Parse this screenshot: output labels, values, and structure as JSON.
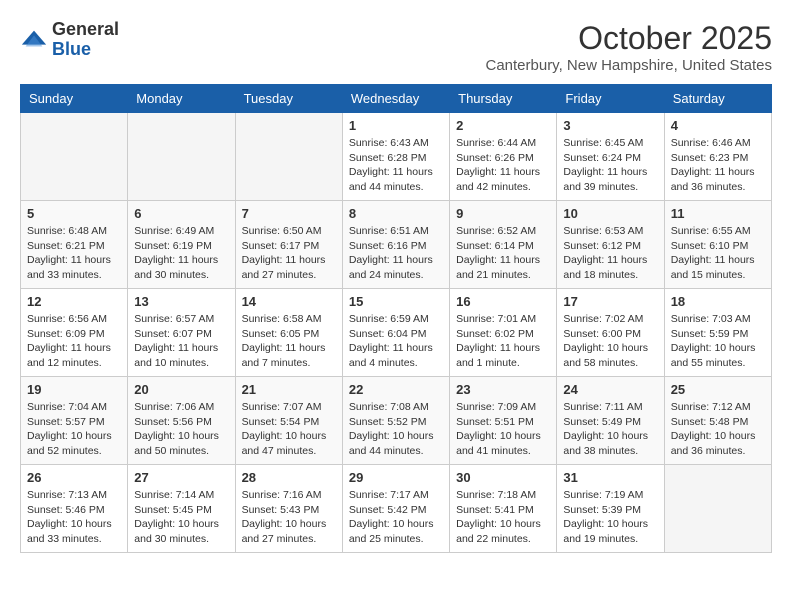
{
  "header": {
    "logo_general": "General",
    "logo_blue": "Blue",
    "month": "October 2025",
    "location": "Canterbury, New Hampshire, United States"
  },
  "weekdays": [
    "Sunday",
    "Monday",
    "Tuesday",
    "Wednesday",
    "Thursday",
    "Friday",
    "Saturday"
  ],
  "weeks": [
    [
      {
        "day": "",
        "sunrise": "",
        "sunset": "",
        "daylight": ""
      },
      {
        "day": "",
        "sunrise": "",
        "sunset": "",
        "daylight": ""
      },
      {
        "day": "",
        "sunrise": "",
        "sunset": "",
        "daylight": ""
      },
      {
        "day": "1",
        "sunrise": "Sunrise: 6:43 AM",
        "sunset": "Sunset: 6:28 PM",
        "daylight": "Daylight: 11 hours and 44 minutes."
      },
      {
        "day": "2",
        "sunrise": "Sunrise: 6:44 AM",
        "sunset": "Sunset: 6:26 PM",
        "daylight": "Daylight: 11 hours and 42 minutes."
      },
      {
        "day": "3",
        "sunrise": "Sunrise: 6:45 AM",
        "sunset": "Sunset: 6:24 PM",
        "daylight": "Daylight: 11 hours and 39 minutes."
      },
      {
        "day": "4",
        "sunrise": "Sunrise: 6:46 AM",
        "sunset": "Sunset: 6:23 PM",
        "daylight": "Daylight: 11 hours and 36 minutes."
      }
    ],
    [
      {
        "day": "5",
        "sunrise": "Sunrise: 6:48 AM",
        "sunset": "Sunset: 6:21 PM",
        "daylight": "Daylight: 11 hours and 33 minutes."
      },
      {
        "day": "6",
        "sunrise": "Sunrise: 6:49 AM",
        "sunset": "Sunset: 6:19 PM",
        "daylight": "Daylight: 11 hours and 30 minutes."
      },
      {
        "day": "7",
        "sunrise": "Sunrise: 6:50 AM",
        "sunset": "Sunset: 6:17 PM",
        "daylight": "Daylight: 11 hours and 27 minutes."
      },
      {
        "day": "8",
        "sunrise": "Sunrise: 6:51 AM",
        "sunset": "Sunset: 6:16 PM",
        "daylight": "Daylight: 11 hours and 24 minutes."
      },
      {
        "day": "9",
        "sunrise": "Sunrise: 6:52 AM",
        "sunset": "Sunset: 6:14 PM",
        "daylight": "Daylight: 11 hours and 21 minutes."
      },
      {
        "day": "10",
        "sunrise": "Sunrise: 6:53 AM",
        "sunset": "Sunset: 6:12 PM",
        "daylight": "Daylight: 11 hours and 18 minutes."
      },
      {
        "day": "11",
        "sunrise": "Sunrise: 6:55 AM",
        "sunset": "Sunset: 6:10 PM",
        "daylight": "Daylight: 11 hours and 15 minutes."
      }
    ],
    [
      {
        "day": "12",
        "sunrise": "Sunrise: 6:56 AM",
        "sunset": "Sunset: 6:09 PM",
        "daylight": "Daylight: 11 hours and 12 minutes."
      },
      {
        "day": "13",
        "sunrise": "Sunrise: 6:57 AM",
        "sunset": "Sunset: 6:07 PM",
        "daylight": "Daylight: 11 hours and 10 minutes."
      },
      {
        "day": "14",
        "sunrise": "Sunrise: 6:58 AM",
        "sunset": "Sunset: 6:05 PM",
        "daylight": "Daylight: 11 hours and 7 minutes."
      },
      {
        "day": "15",
        "sunrise": "Sunrise: 6:59 AM",
        "sunset": "Sunset: 6:04 PM",
        "daylight": "Daylight: 11 hours and 4 minutes."
      },
      {
        "day": "16",
        "sunrise": "Sunrise: 7:01 AM",
        "sunset": "Sunset: 6:02 PM",
        "daylight": "Daylight: 11 hours and 1 minute."
      },
      {
        "day": "17",
        "sunrise": "Sunrise: 7:02 AM",
        "sunset": "Sunset: 6:00 PM",
        "daylight": "Daylight: 10 hours and 58 minutes."
      },
      {
        "day": "18",
        "sunrise": "Sunrise: 7:03 AM",
        "sunset": "Sunset: 5:59 PM",
        "daylight": "Daylight: 10 hours and 55 minutes."
      }
    ],
    [
      {
        "day": "19",
        "sunrise": "Sunrise: 7:04 AM",
        "sunset": "Sunset: 5:57 PM",
        "daylight": "Daylight: 10 hours and 52 minutes."
      },
      {
        "day": "20",
        "sunrise": "Sunrise: 7:06 AM",
        "sunset": "Sunset: 5:56 PM",
        "daylight": "Daylight: 10 hours and 50 minutes."
      },
      {
        "day": "21",
        "sunrise": "Sunrise: 7:07 AM",
        "sunset": "Sunset: 5:54 PM",
        "daylight": "Daylight: 10 hours and 47 minutes."
      },
      {
        "day": "22",
        "sunrise": "Sunrise: 7:08 AM",
        "sunset": "Sunset: 5:52 PM",
        "daylight": "Daylight: 10 hours and 44 minutes."
      },
      {
        "day": "23",
        "sunrise": "Sunrise: 7:09 AM",
        "sunset": "Sunset: 5:51 PM",
        "daylight": "Daylight: 10 hours and 41 minutes."
      },
      {
        "day": "24",
        "sunrise": "Sunrise: 7:11 AM",
        "sunset": "Sunset: 5:49 PM",
        "daylight": "Daylight: 10 hours and 38 minutes."
      },
      {
        "day": "25",
        "sunrise": "Sunrise: 7:12 AM",
        "sunset": "Sunset: 5:48 PM",
        "daylight": "Daylight: 10 hours and 36 minutes."
      }
    ],
    [
      {
        "day": "26",
        "sunrise": "Sunrise: 7:13 AM",
        "sunset": "Sunset: 5:46 PM",
        "daylight": "Daylight: 10 hours and 33 minutes."
      },
      {
        "day": "27",
        "sunrise": "Sunrise: 7:14 AM",
        "sunset": "Sunset: 5:45 PM",
        "daylight": "Daylight: 10 hours and 30 minutes."
      },
      {
        "day": "28",
        "sunrise": "Sunrise: 7:16 AM",
        "sunset": "Sunset: 5:43 PM",
        "daylight": "Daylight: 10 hours and 27 minutes."
      },
      {
        "day": "29",
        "sunrise": "Sunrise: 7:17 AM",
        "sunset": "Sunset: 5:42 PM",
        "daylight": "Daylight: 10 hours and 25 minutes."
      },
      {
        "day": "30",
        "sunrise": "Sunrise: 7:18 AM",
        "sunset": "Sunset: 5:41 PM",
        "daylight": "Daylight: 10 hours and 22 minutes."
      },
      {
        "day": "31",
        "sunrise": "Sunrise: 7:19 AM",
        "sunset": "Sunset: 5:39 PM",
        "daylight": "Daylight: 10 hours and 19 minutes."
      },
      {
        "day": "",
        "sunrise": "",
        "sunset": "",
        "daylight": ""
      }
    ]
  ]
}
